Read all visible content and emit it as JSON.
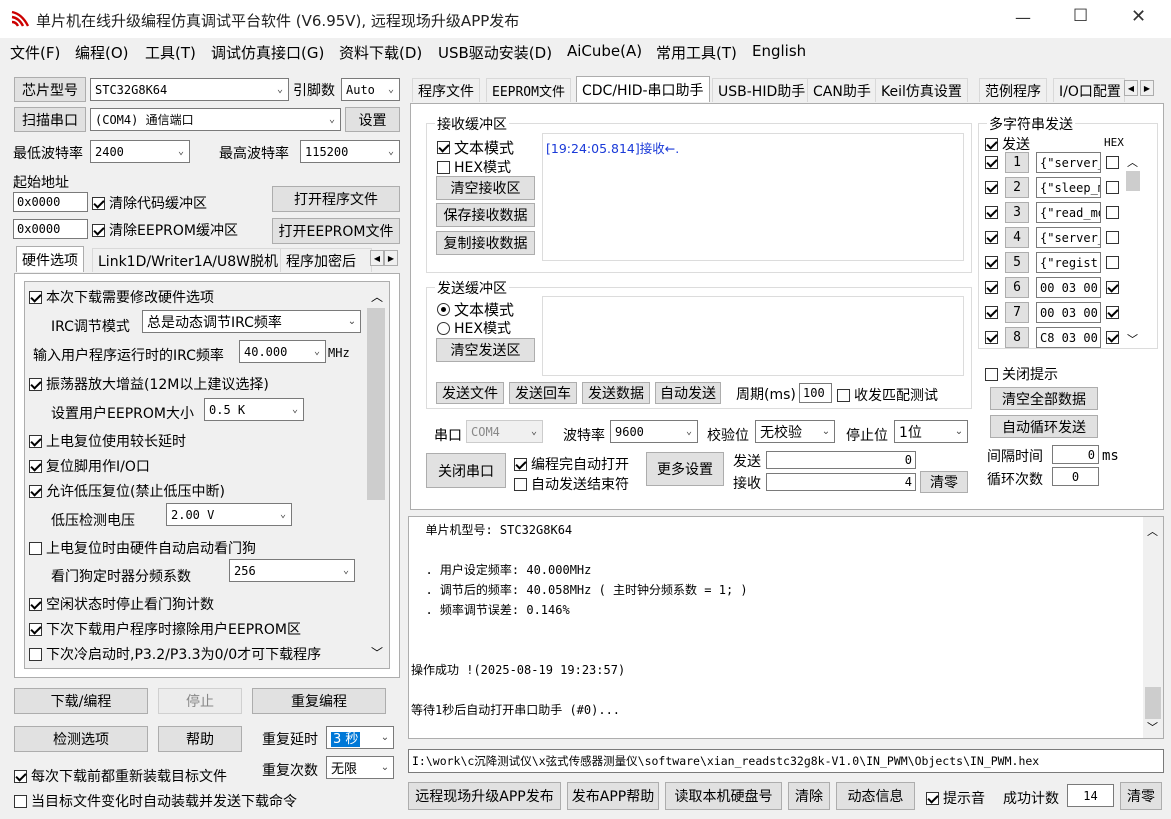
{
  "window": {
    "title": "单片机在线升级编程仿真调试平台软件 (V6.95V), 远程现场升级APP发布",
    "minimize": "—",
    "maximize": "☐",
    "close": "✕"
  },
  "menu": [
    "文件(F)",
    "编程(O)",
    "工具(T)",
    "调试仿真接口(G)",
    "资料下载(D)",
    "USB驱动安装(D)",
    "AiCube(A)",
    "常用工具(T)",
    "English"
  ],
  "left": {
    "chip_btn": "芯片型号",
    "chip_value": "STC32G8K64",
    "pins_label": "引脚数",
    "pins_value": "Auto",
    "scan_btn": "扫描串口",
    "port_value": "(COM4) 通信端口",
    "settings_btn": "设置",
    "min_baud_label": "最低波特率",
    "min_baud": "2400",
    "max_baud_label": "最高波特率",
    "max_baud": "115200",
    "start_addr_label": "起始地址",
    "addr1": "0x0000",
    "clear_code": "清除代码缓冲区",
    "open_prog": "打开程序文件",
    "addr2": "0x0000",
    "clear_eeprom": "清除EEPROM缓冲区",
    "open_eeprom": "打开EEPROM文件",
    "tabs": [
      "硬件选项",
      "Link1D/Writer1A/U8W脱机",
      "程序加密后"
    ],
    "options": {
      "opt1": "本次下载需要修改硬件选项",
      "irc_mode_label": "IRC调节模式",
      "irc_mode_value": "总是动态调节IRC频率",
      "freq_label": "输入用户程序运行时的IRC频率",
      "freq_value": "40.000",
      "freq_unit": "MHz",
      "opt2": "振荡器放大增益(12M以上建议选择)",
      "eeprom_size_label": "设置用户EEPROM大小",
      "eeprom_size": "0.5 K",
      "opt3": "上电复位使用较长延时",
      "opt4": "复位脚用作I/O口",
      "opt5": "允许低压复位(禁止低压中断)",
      "lvd_label": "低压检测电压",
      "lvd_value": "2.00 V",
      "opt6": "上电复位时由硬件自动启动看门狗",
      "wdt_label": "看门狗定时器分频系数",
      "wdt_value": "256",
      "opt7": "空闲状态时停止看门狗计数",
      "opt8": "下次下载用户程序时擦除用户EEPROM区",
      "opt9": "下次冷启动时,P3.2/P3.3为0/0才可下载程序"
    },
    "download_btn": "下载/编程",
    "stop_btn": "停止",
    "reprogram_btn": "重复编程",
    "detect_btn": "检测选项",
    "help_btn": "帮助",
    "repeat_delay_label": "重复延时",
    "repeat_delay": "3 秒",
    "repeat_count_label": "重复次数",
    "repeat_count": "无限",
    "reload_each": "每次下载前都重新装载目标文件",
    "reload_change": "当目标文件变化时自动装载并发送下载命令"
  },
  "right": {
    "tabs": [
      "程序文件",
      "EEPROM文件",
      "CDC/HID-串口助手",
      "USB-HID助手",
      "CAN助手",
      "Keil仿真设置",
      "范例程序",
      "I/O口配置"
    ],
    "recv": {
      "title": "接收缓冲区",
      "text_mode": "文本模式",
      "hex_mode": "HEX模式",
      "clear": "清空接收区",
      "save": "保存接收数据",
      "copy": "复制接收数据",
      "content": "[19:24:05.814]接收←."
    },
    "send": {
      "title": "发送缓冲区",
      "text_mode": "文本模式",
      "hex_mode": "HEX模式",
      "clear": "清空发送区",
      "send_file": "发送文件",
      "send_cr": "发送回车",
      "send_data": "发送数据",
      "auto_send": "自动发送",
      "period_label": "周期(ms)",
      "period": "100",
      "match_test": "收发匹配测试"
    },
    "serial": {
      "port_label": "串口",
      "port": "COM4",
      "baud_label": "波特率",
      "baud": "9600",
      "parity_label": "校验位",
      "parity": "无校验",
      "stop_label": "停止位",
      "stop": "1位",
      "close_btn": "关闭串口",
      "auto_open": "编程完自动打开",
      "auto_end": "自动发送结束符",
      "more_btn": "更多设置",
      "send_label": "发送",
      "send_count": "0",
      "recv_label": "接收",
      "recv_count": "4",
      "clear_btn": "清零"
    },
    "multi": {
      "title": "多字符串发送",
      "send_label": "发送",
      "hex_label": "HEX",
      "rows": [
        {
          "n": "1",
          "text": "{\"server_",
          "hex": false
        },
        {
          "n": "2",
          "text": "{\"sleep_m",
          "hex": false
        },
        {
          "n": "3",
          "text": "{\"read_mo",
          "hex": false
        },
        {
          "n": "4",
          "text": "{\"server_",
          "hex": false
        },
        {
          "n": "5",
          "text": "{\"regist",
          "hex": false
        },
        {
          "n": "6",
          "text": "00 03 00",
          "hex": true
        },
        {
          "n": "7",
          "text": "00 03 00",
          "hex": true
        },
        {
          "n": "8",
          "text": "C8 03 00",
          "hex": true
        }
      ],
      "close_tip": "关闭提示",
      "clear_all": "清空全部数据",
      "auto_loop": "自动循环发送",
      "interval_label": "间隔时间",
      "interval": "0",
      "interval_unit": "ms",
      "loop_label": "循环次数",
      "loop": "0"
    },
    "log": [
      "  单片机型号: STC32G8K64",
      "",
      "  . 用户设定频率: 40.000MHz",
      "  . 调节后的频率: 40.058MHz ( 主时钟分频系数 = 1; )",
      "  . 频率调节误差: 0.146%",
      "",
      "",
      "操作成功 !(2025-08-19 19:23:57)",
      "",
      "等待1秒后自动打开串口助手 (#0)..."
    ],
    "path": "I:\\work\\c沉降测试仪\\x弦式传感器测量仪\\software\\xian_readstc32g8k-V1.0\\IN_PWM\\Objects\\IN_PWM.hex",
    "bottom": {
      "remote_publish": "远程现场升级APP发布",
      "publish_help": "发布APP帮助",
      "read_disk": "读取本机硬盘号",
      "clear": "清除",
      "dynamic": "动态信息",
      "beep": "提示音",
      "success_label": "成功计数",
      "success_count": "14",
      "clear2": "清零"
    }
  }
}
